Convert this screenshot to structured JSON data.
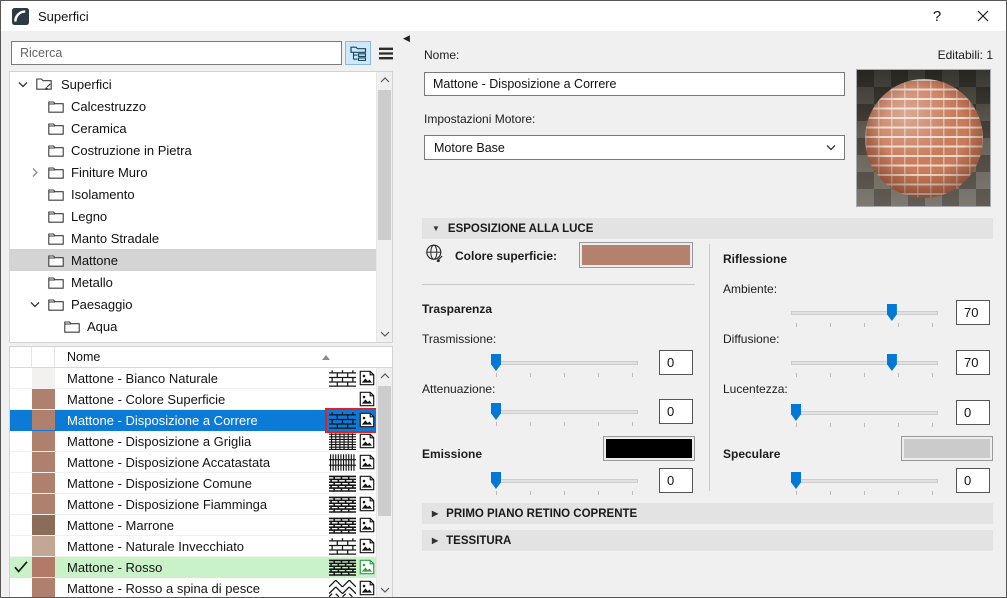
{
  "window": {
    "title": "Superfici",
    "help_label": "?"
  },
  "left": {
    "search": {
      "placeholder": "Ricerca"
    },
    "tree": {
      "items": [
        {
          "label": "Superfici"
        },
        {
          "label": "Calcestruzzo"
        },
        {
          "label": "Ceramica"
        },
        {
          "label": "Costruzione in Pietra"
        },
        {
          "label": "Finiture Muro"
        },
        {
          "label": "Isolamento"
        },
        {
          "label": "Legno"
        },
        {
          "label": "Manto Stradale"
        },
        {
          "label": "Mattone"
        },
        {
          "label": "Metallo"
        },
        {
          "label": "Paesaggio"
        },
        {
          "label": "Aqua"
        }
      ]
    },
    "list": {
      "header": "Nome",
      "rows": [
        {
          "name": "Mattone - Bianco Naturale",
          "swatch": "#f3f1ef"
        },
        {
          "name": "Mattone - Colore Superficie",
          "swatch": "#b0806e"
        },
        {
          "name": "Mattone - Disposizione a Correre",
          "swatch": "#b0806e"
        },
        {
          "name": "Mattone - Disposizione a Griglia",
          "swatch": "#b0806e"
        },
        {
          "name": "Mattone - Disposizione Accatastata",
          "swatch": "#b0806e"
        },
        {
          "name": "Mattone - Disposizione Comune",
          "swatch": "#b0806e"
        },
        {
          "name": "Mattone - Disposizione Fiamminga",
          "swatch": "#b0806e"
        },
        {
          "name": "Mattone - Marrone",
          "swatch": "#8c6b58"
        },
        {
          "name": "Mattone - Naturale Invecchiato",
          "swatch": "#c3a794"
        },
        {
          "name": "Mattone - Rosso",
          "swatch": "#b27a69"
        },
        {
          "name": "Mattone - Rosso a spina di pesce",
          "swatch": "#b0806e"
        }
      ]
    }
  },
  "right": {
    "name_label": "Nome:",
    "editable_count": "Editabili: 1",
    "name_value": "Mattone - Disposizione a Correre",
    "engine_label": "Impostazioni Motore:",
    "engine_value": "Motore Base",
    "sections": {
      "light": "ESPOSIZIONE ALLA LUCE",
      "retino": "PRIMO PIANO RETINO COPRENTE",
      "tessitura": "TESSITURA"
    },
    "surface_color_label": "Colore superficie:",
    "groups": {
      "transparency": "Trasparenza",
      "reflection": "Riflessione",
      "emission": "Emissione",
      "specular": "Speculare"
    },
    "sliders": {
      "trasmissione": {
        "label": "Trasmissione:",
        "value": 0
      },
      "attenuazione": {
        "label": "Attenuazione:",
        "value": 0
      },
      "emissione": {
        "value": 0
      },
      "ambiente": {
        "label": "Ambiente:",
        "value": 70
      },
      "diffusione": {
        "label": "Diffusione:",
        "value": 70
      },
      "lucentezza": {
        "label": "Lucentezza:",
        "value": 0
      },
      "speculare": {
        "value": 0
      }
    },
    "colors": {
      "surface": "#b5816f",
      "emission": "#000000",
      "specular": "#cbcbcb",
      "accent": "#0078d7",
      "selected_row": "#0c7bd8",
      "checked_row": "#c9f2c9",
      "annotation": "#e32020"
    }
  }
}
